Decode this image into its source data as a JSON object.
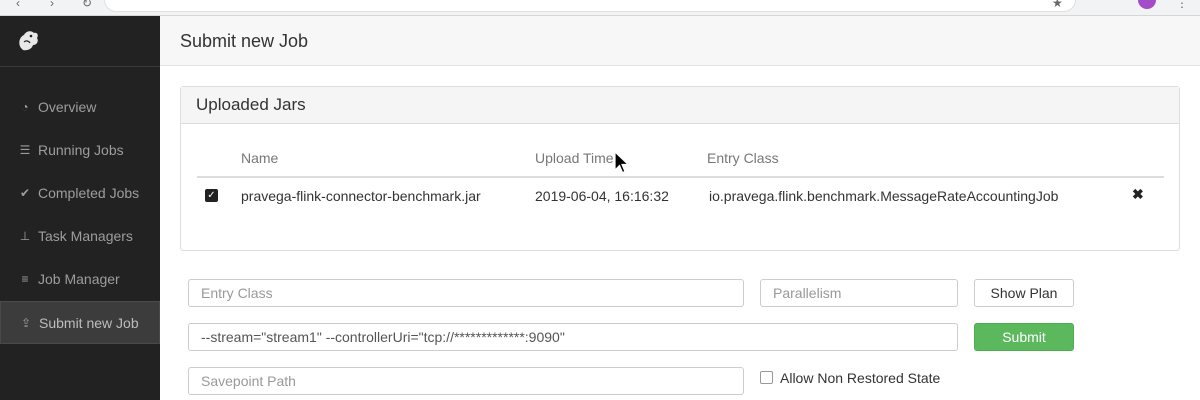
{
  "browser": {
    "icons": [
      "back-icon",
      "forward-icon",
      "reload-icon",
      "info-icon",
      "star-icon",
      "menu-icon"
    ]
  },
  "sidebar": {
    "items": [
      {
        "label": "Overview",
        "icon": "dashboard-icon"
      },
      {
        "label": "Running Jobs",
        "icon": "list-icon"
      },
      {
        "label": "Completed Jobs",
        "icon": "check-circle-icon"
      },
      {
        "label": "Task Managers",
        "icon": "sitemap-icon"
      },
      {
        "label": "Job Manager",
        "icon": "tasks-icon"
      },
      {
        "label": "Submit new Job",
        "icon": "upload-icon",
        "active": true
      }
    ]
  },
  "header": {
    "title": "Submit new Job"
  },
  "jars_panel": {
    "title": "Uploaded Jars",
    "columns": [
      "Name",
      "Upload Time",
      "Entry Class"
    ],
    "rows": [
      {
        "checked": true,
        "name": "pravega-flink-connector-benchmark.jar",
        "upload_time": "2019-06-04, 16:16:32",
        "entry_class": "io.pravega.flink.benchmark.MessageRateAccountingJob"
      }
    ]
  },
  "form": {
    "entry_class_placeholder": "Entry Class",
    "parallelism_placeholder": "Parallelism",
    "show_plan_label": "Show Plan",
    "program_args_value": "--stream=\"stream1\" --controllerUri=\"tcp://*************:9090\"",
    "submit_label": "Submit",
    "savepoint_placeholder": "Savepoint Path",
    "allow_non_restored_label": "Allow Non Restored State",
    "allow_non_restored_checked": false
  },
  "colors": {
    "sidebar_bg": "#222222",
    "submit_green": "#5cb85c"
  }
}
